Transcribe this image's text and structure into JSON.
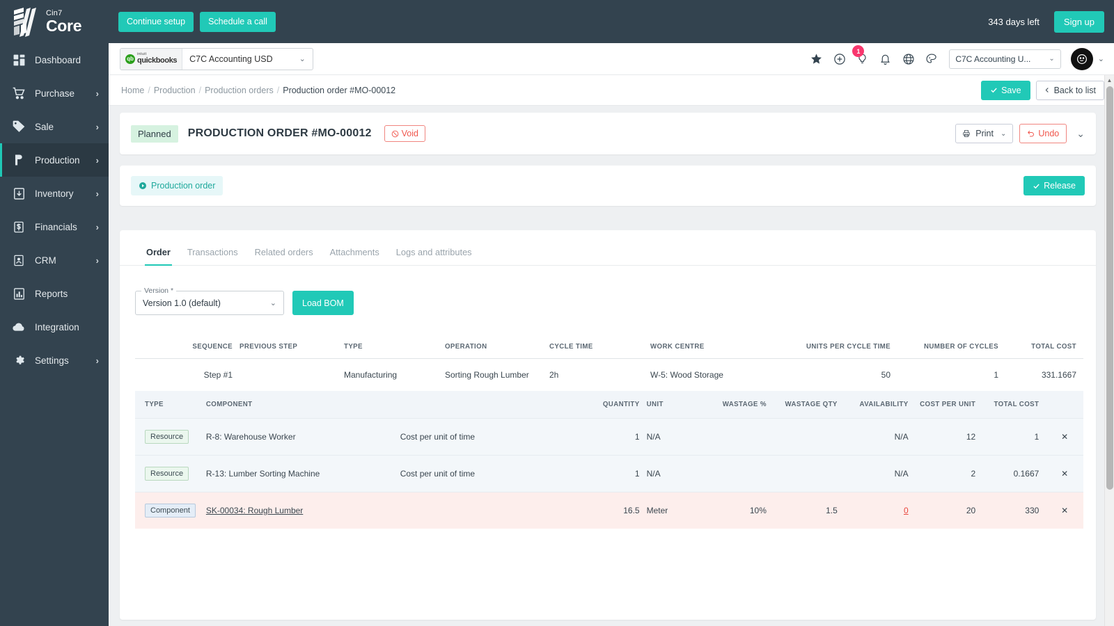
{
  "brand": {
    "top": "Cin7",
    "name": "Core"
  },
  "sidebar": {
    "items": [
      {
        "label": "Dashboard",
        "icon": "dashboard-icon",
        "chevron": "",
        "active": false
      },
      {
        "label": "Purchase",
        "icon": "cart-icon",
        "chevron": "›",
        "active": false
      },
      {
        "label": "Sale",
        "icon": "tag-icon",
        "chevron": "›",
        "active": false
      },
      {
        "label": "Production",
        "icon": "production-icon",
        "chevron": "›",
        "active": true
      },
      {
        "label": "Inventory",
        "icon": "inventory-icon",
        "chevron": "›",
        "active": false
      },
      {
        "label": "Financials",
        "icon": "dollar-icon",
        "chevron": "›",
        "active": false
      },
      {
        "label": "CRM",
        "icon": "contact-icon",
        "chevron": "›",
        "active": false
      },
      {
        "label": "Reports",
        "icon": "reports-icon",
        "chevron": "",
        "active": false
      },
      {
        "label": "Integration",
        "icon": "cloud-icon",
        "chevron": "",
        "active": false
      },
      {
        "label": "Settings",
        "icon": "gear-icon",
        "chevron": "›",
        "active": false
      }
    ]
  },
  "topbar": {
    "continue_setup": "Continue setup",
    "schedule_call": "Schedule a call",
    "days_left": "343 days left",
    "sign_up": "Sign up"
  },
  "appbar": {
    "qb_word_top": "intuit",
    "qb_word_main": "quickbooks",
    "qb_badge": "qb",
    "qb_account": "C7C Accounting USD",
    "org_value": "C7C Accounting U...",
    "notification_count": "1",
    "icons": [
      "star-icon",
      "plus-circle-icon",
      "lightbulb-icon",
      "bell-icon",
      "globe-icon",
      "palette-icon"
    ]
  },
  "breadcrumb": {
    "items": [
      "Home",
      "Production",
      "Production orders"
    ],
    "current": "Production order #MO-00012",
    "save_label": "Save",
    "back_label": "Back to list"
  },
  "order_header": {
    "status": "Planned",
    "title": "PRODUCTION ORDER #MO-00012",
    "void_label": "Void",
    "print_label": "Print",
    "undo_label": "Undo"
  },
  "stage": {
    "label": "Production order",
    "release_label": "Release"
  },
  "tabs": [
    {
      "label": "Order",
      "active": true
    },
    {
      "label": "Transactions",
      "active": false
    },
    {
      "label": "Related orders",
      "active": false
    },
    {
      "label": "Attachments",
      "active": false
    },
    {
      "label": "Logs and attributes",
      "active": false
    }
  ],
  "version": {
    "label": "Version",
    "required": "*",
    "value": "Version 1.0 (default)",
    "load_bom_label": "Load BOM"
  },
  "steps_table": {
    "columns": [
      "SEQUENCE",
      "PREVIOUS STEP",
      "TYPE",
      "OPERATION",
      "CYCLE TIME",
      "WORK CENTRE",
      "UNITS PER CYCLE TIME",
      "NUMBER OF CYCLES",
      "TOTAL COST"
    ],
    "rows": [
      {
        "sequence": "Step #1",
        "previous_step": "",
        "type": "Manufacturing",
        "operation": "Sorting Rough Lumber",
        "cycle_time": "2h",
        "work_centre": "W-5: Wood Storage",
        "units_per_cycle_time": "50",
        "number_of_cycles": "1",
        "total_cost": "331.1667"
      }
    ]
  },
  "components_table": {
    "columns": [
      "TYPE",
      "COMPONENT",
      "",
      "QUANTITY",
      "UNIT",
      "WASTAGE %",
      "WASTAGE QTY",
      "AVAILABILITY",
      "COST PER UNIT",
      "TOTAL COST",
      ""
    ],
    "rows": [
      {
        "type": "Resource",
        "type_style": "resource",
        "component": "R-8: Warehouse Worker",
        "component_link": false,
        "note": "Cost per unit of time",
        "quantity": "1",
        "unit": "N/A",
        "wastage_pct": "",
        "wastage_qty": "",
        "availability": "N/A",
        "availability_zero": false,
        "cost_per_unit": "12",
        "total_cost": "1",
        "remove": "✕",
        "row_style": "alt"
      },
      {
        "type": "Resource",
        "type_style": "resource",
        "component": "R-13: Lumber Sorting Machine",
        "component_link": false,
        "note": "Cost per unit of time",
        "quantity": "1",
        "unit": "N/A",
        "wastage_pct": "",
        "wastage_qty": "",
        "availability": "N/A",
        "availability_zero": false,
        "cost_per_unit": "2",
        "total_cost": "0.1667",
        "remove": "✕",
        "row_style": "alt"
      },
      {
        "type": "Component",
        "type_style": "component",
        "component": "SK-00034: Rough Lumber",
        "component_link": true,
        "note": "",
        "quantity": "16.5",
        "unit": "Meter",
        "wastage_pct": "10%",
        "wastage_qty": "1.5",
        "availability": "0",
        "availability_zero": true,
        "cost_per_unit": "20",
        "total_cost": "330",
        "remove": "✕",
        "row_style": "warn"
      }
    ]
  },
  "colors": {
    "accent_teal": "#21c9b7",
    "sidebar_bg": "#33434f",
    "danger_red": "#e8453c",
    "badge_pink": "#f8376e",
    "planned_green": "#d6f2e0"
  }
}
